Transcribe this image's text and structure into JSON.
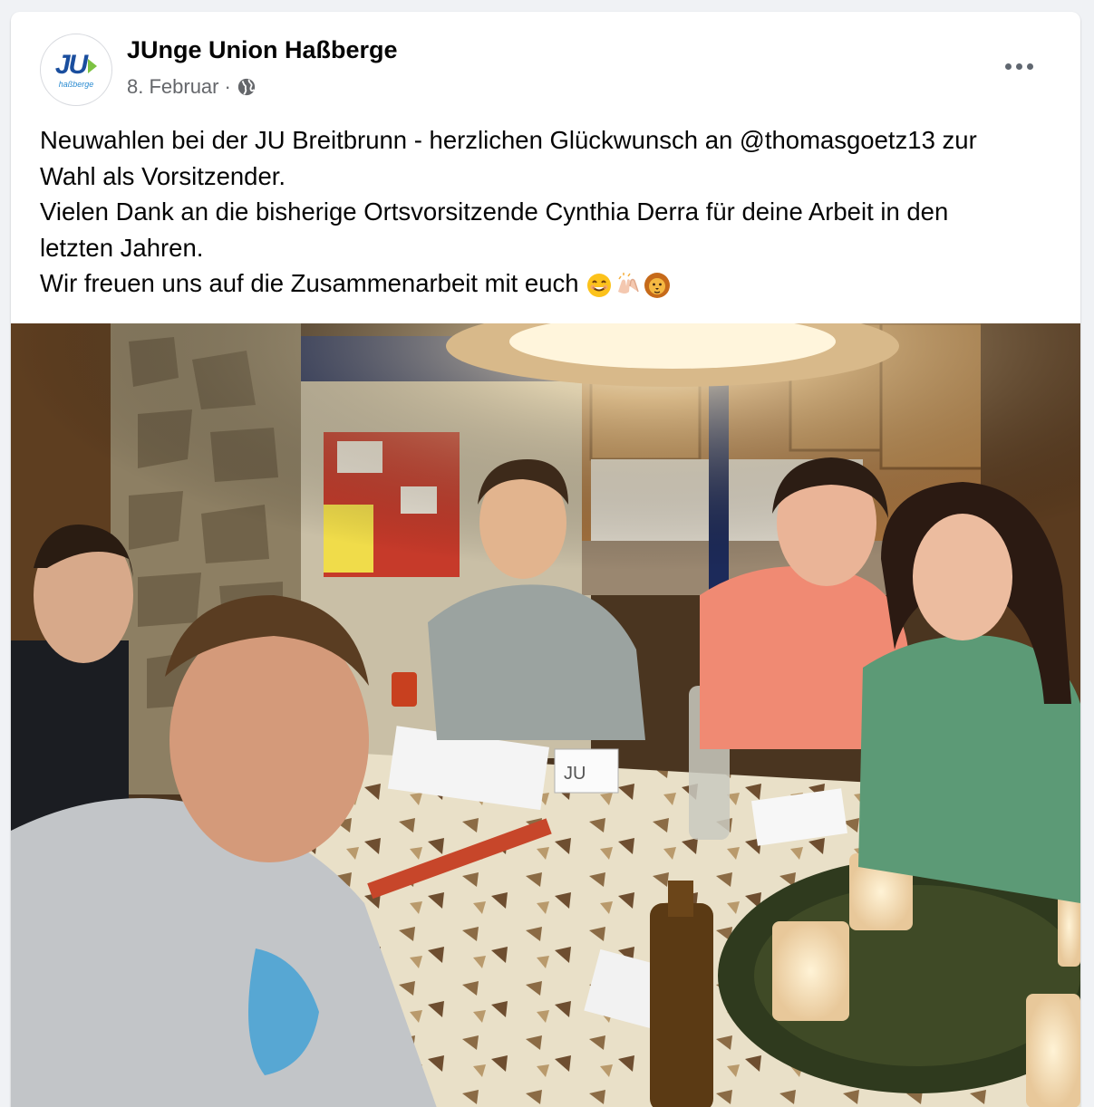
{
  "post": {
    "page_name": "JUnge Union Haßberge",
    "date": "8. Februar",
    "separator": "·",
    "privacy_icon": "globe-icon",
    "more_icon": "more-options-icon",
    "avatar": {
      "logo_text": "JU",
      "logo_subtext": "haßberge"
    },
    "text_lines": [
      "Neuwahlen bei der JU Breitbrunn - herzlichen Glückwunsch an @thomasgoetz13 zur",
      "Wahl als Vorsitzender.",
      "Vielen Dank an die bisherige Ortsvorsitzende Cynthia Derra für deine Arbeit in den",
      "letzten Jahren.",
      "Wir freuen uns auf die Zusammenarbeit mit euch"
    ],
    "emojis": [
      "smiling-face-emoji",
      "clapping-hands-emoji",
      "lion-face-emoji"
    ],
    "photo_sign_text": "JU"
  },
  "colors": {
    "background": "#f0f2f5",
    "card": "#ffffff",
    "text": "#050505",
    "secondary_text": "#65676b",
    "logo_blue": "#1a4e9e",
    "logo_green": "#7cc242"
  }
}
